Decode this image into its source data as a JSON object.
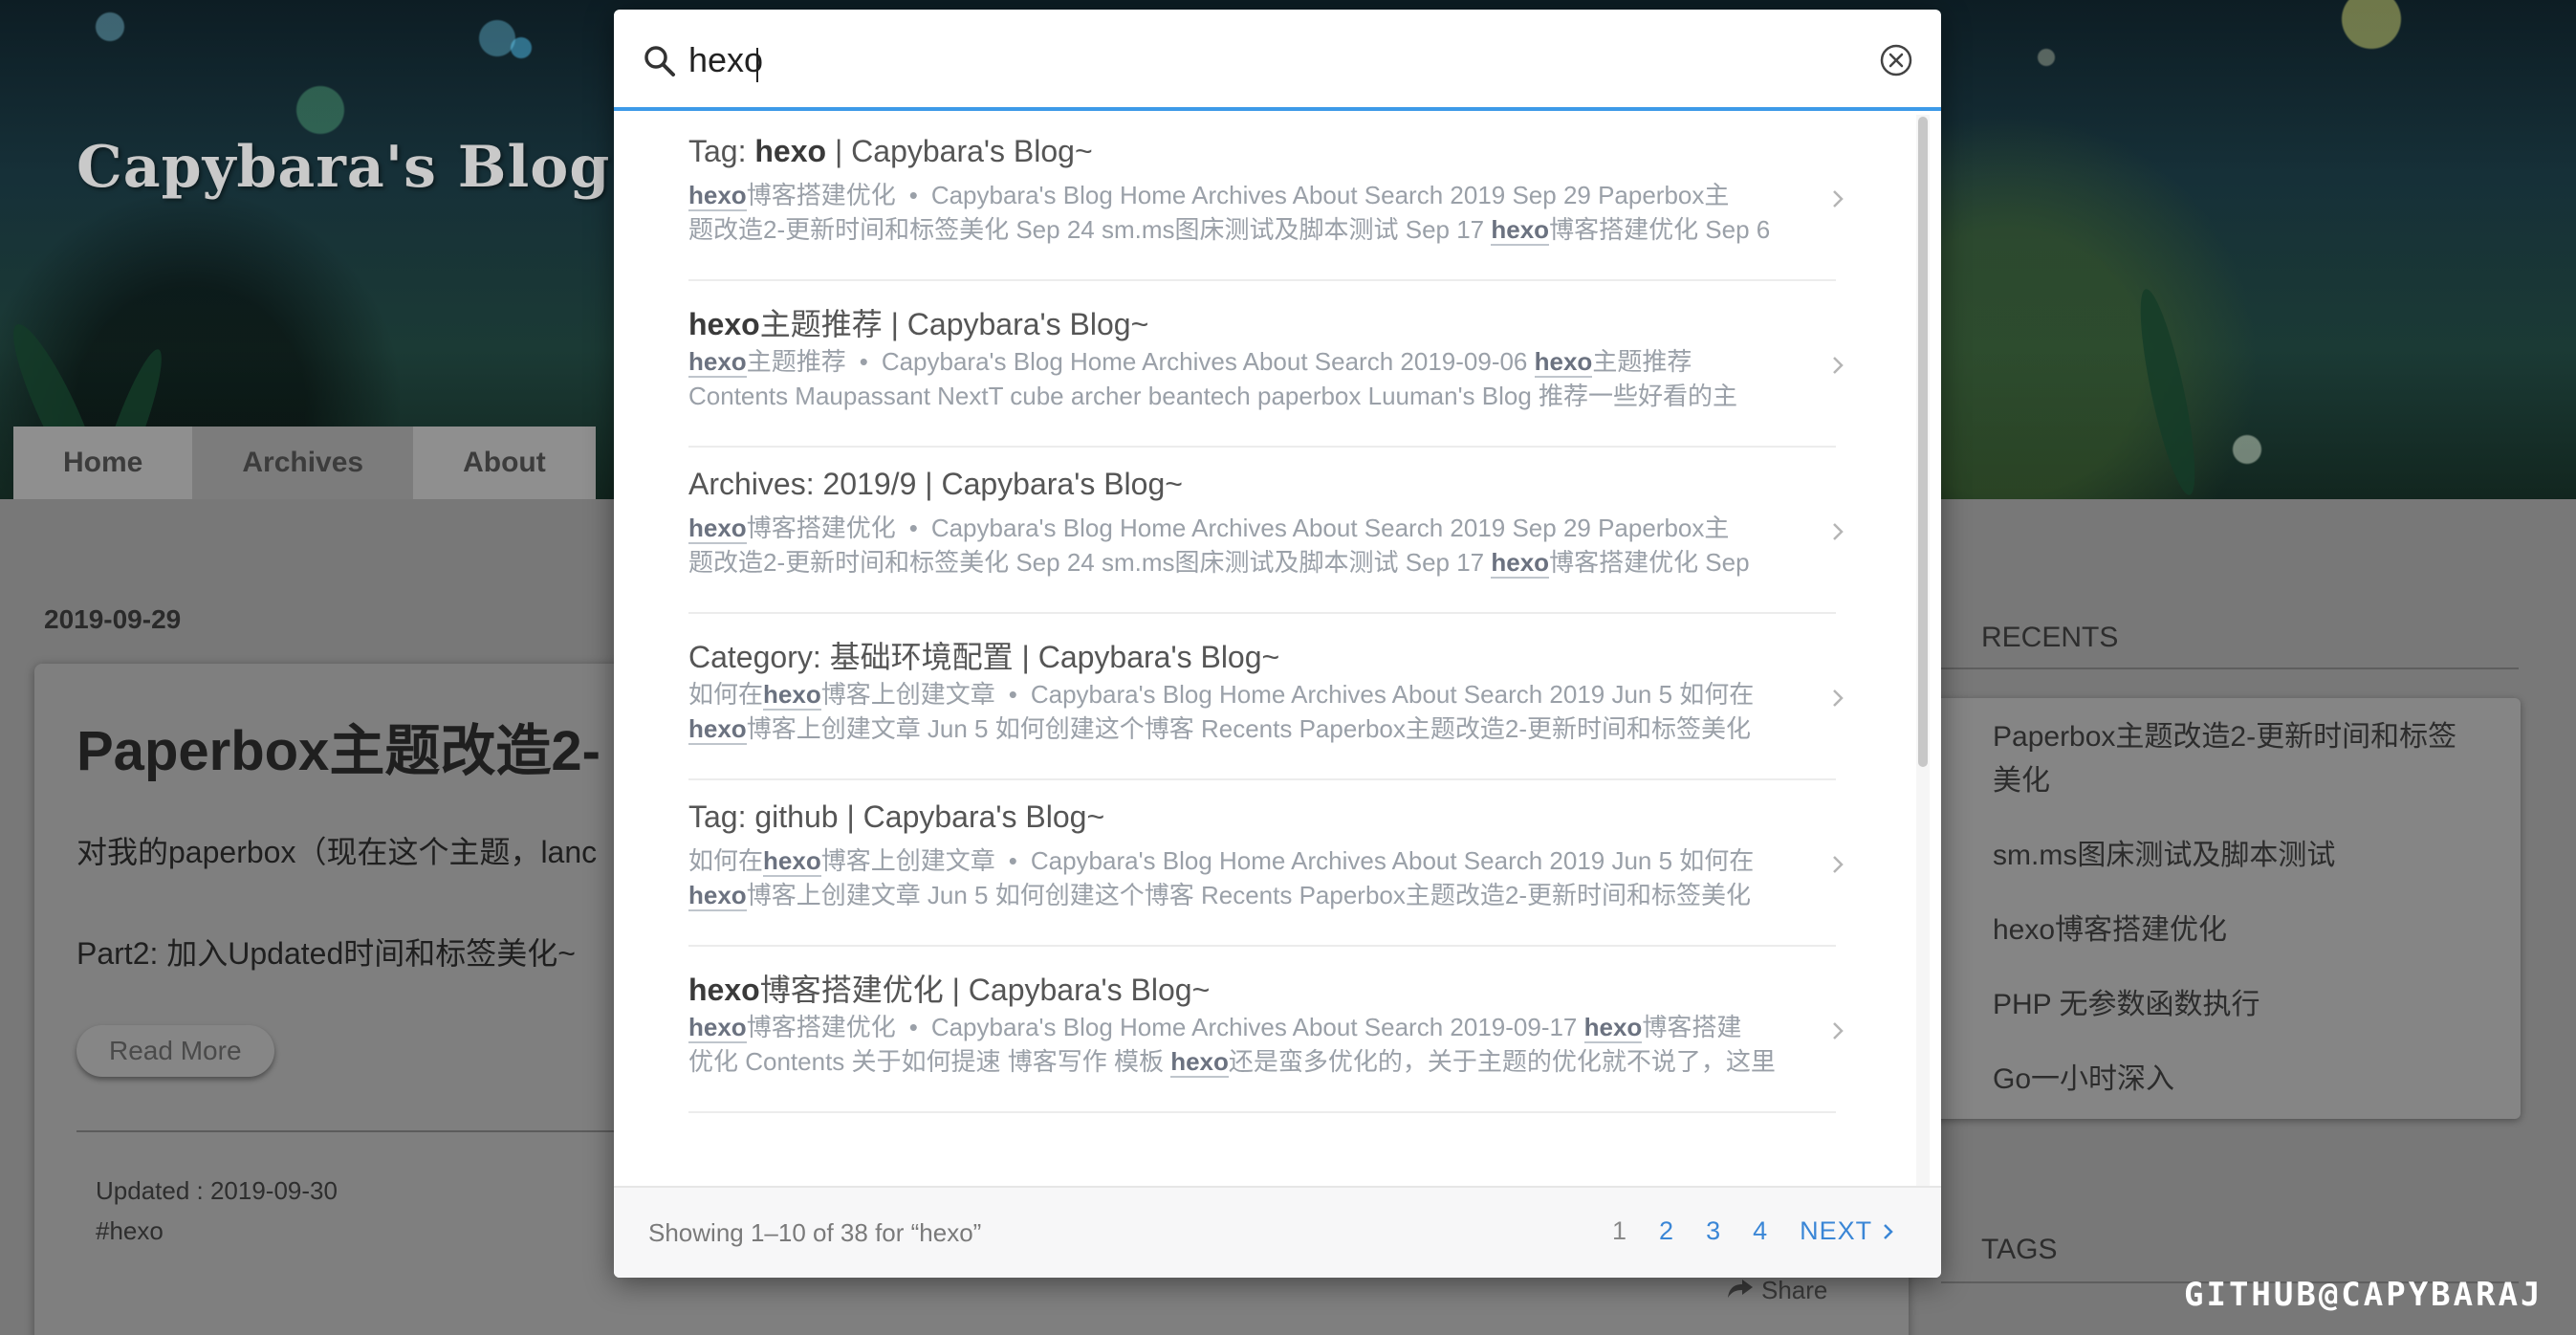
{
  "blog": {
    "title": "Capybara's Blog~",
    "nav": [
      "Home",
      "Archives",
      "About"
    ],
    "post": {
      "date": "2019-09-29",
      "title": "Paperbox主题改造2-",
      "line1": "对我的paperbox（现在这个主题，lanc",
      "line2": "Part2: 加入Updated时间和标签美化~",
      "read_more": "Read More",
      "updated": "Updated : 2019-09-30",
      "tag": "#hexo",
      "share": "Share"
    },
    "sidebar": {
      "recents_heading": "RECENTS",
      "recents": [
        "Paperbox主题改造2-更新时间和标签美化",
        "sm.ms图床测试及脚本测试",
        "hexo博客搭建优化",
        "PHP 无参数函数执行",
        "Go一小时深入"
      ],
      "tags_heading": "TAGS"
    },
    "watermark": "GITHUB@CAPYBARAJ"
  },
  "search": {
    "query": "hexo",
    "icons": {
      "search": "search-icon",
      "clear": "clear-circle-x-icon",
      "chevron": "chevron-right-icon"
    },
    "accent_color": "#3d9ae8",
    "results": [
      {
        "title_pre": "Tag: ",
        "title_kw": "hexo",
        "title_post": " | Capybara's Blog~",
        "line1": [
          [
            "kw",
            "hexo"
          ],
          [
            "t",
            "博客搭建优化"
          ],
          [
            "b",
            "•"
          ],
          [
            "t",
            "Capybara's Blog Home Archives About Search 2019 Sep 29 Paperbox主"
          ]
        ],
        "line2": [
          [
            "t",
            "题改造2-更新时间和标签美化 Sep 24 sm.ms图床测试及脚本测试 Sep 17 "
          ],
          [
            "kw",
            "hexo"
          ],
          [
            "t",
            "博客搭建优化 Sep 6"
          ]
        ]
      },
      {
        "title_pre": "",
        "title_kw": "hexo",
        "title_post": "主题推荐 | Capybara's Blog~",
        "line1": [
          [
            "kw",
            "hexo"
          ],
          [
            "t",
            "主题推荐"
          ],
          [
            "b",
            "•"
          ],
          [
            "t",
            "Capybara's Blog Home Archives About Search 2019-09-06 "
          ],
          [
            "kw",
            "hexo"
          ],
          [
            "t",
            "主题推荐"
          ]
        ],
        "line2": [
          [
            "t",
            "Contents Maupassant NextT cube archer beantech paperbox Luuman's Blog 推荐一些好看的主"
          ]
        ]
      },
      {
        "title_pre": "Archives: 2019/9 | Capybara's Blog~",
        "title_kw": "",
        "title_post": "",
        "line1": [
          [
            "kw",
            "hexo"
          ],
          [
            "t",
            "博客搭建优化"
          ],
          [
            "b",
            "•"
          ],
          [
            "t",
            "Capybara's Blog Home Archives About Search 2019 Sep 29 Paperbox主"
          ]
        ],
        "line2": [
          [
            "t",
            "题改造2-更新时间和标签美化 Sep 24 sm.ms图床测试及脚本测试 Sep 17 "
          ],
          [
            "kw",
            "hexo"
          ],
          [
            "t",
            "博客搭建优化 Sep"
          ]
        ]
      },
      {
        "title_pre": "Category: 基础环境配置 | Capybara's Blog~",
        "title_kw": "",
        "title_post": "",
        "line1": [
          [
            "t",
            "如何在"
          ],
          [
            "kw",
            "hexo"
          ],
          [
            "t",
            "博客上创建文章"
          ],
          [
            "b",
            "•"
          ],
          [
            "t",
            "Capybara's Blog Home Archives About Search 2019 Jun 5 如何在"
          ]
        ],
        "line2": [
          [
            "kw",
            "hexo"
          ],
          [
            "t",
            "博客上创建文章 Jun 5 如何创建这个博客 Recents Paperbox主题改造2-更新时间和标签美化"
          ]
        ]
      },
      {
        "title_pre": "Tag: github | Capybara's Blog~",
        "title_kw": "",
        "title_post": "",
        "line1": [
          [
            "t",
            "如何在"
          ],
          [
            "kw",
            "hexo"
          ],
          [
            "t",
            "博客上创建文章"
          ],
          [
            "b",
            "•"
          ],
          [
            "t",
            "Capybara's Blog Home Archives About Search 2019 Jun 5 如何在"
          ]
        ],
        "line2": [
          [
            "kw",
            "hexo"
          ],
          [
            "t",
            "博客上创建文章 Jun 5 如何创建这个博客 Recents Paperbox主题改造2-更新时间和标签美化"
          ]
        ]
      },
      {
        "title_pre": "",
        "title_kw": "hexo",
        "title_post": "博客搭建优化 | Capybara's Blog~",
        "line1": [
          [
            "kw",
            "hexo"
          ],
          [
            "t",
            "博客搭建优化"
          ],
          [
            "b",
            "•"
          ],
          [
            "t",
            "Capybara's Blog Home Archives About Search 2019-09-17 "
          ],
          [
            "kw",
            "hexo"
          ],
          [
            "t",
            "博客搭建"
          ]
        ],
        "line2": [
          [
            "t",
            "优化 Contents 关于如何提速 博客写作 模板 "
          ],
          [
            "kw",
            "hexo"
          ],
          [
            "t",
            "还是蛮多优化的，关于主题的优化就不说了，这里"
          ]
        ]
      }
    ],
    "footer": {
      "summary": "Showing 1–10 of 38 for “hexo”",
      "pages": [
        "1",
        "2",
        "3",
        "4"
      ],
      "current_page": "1",
      "next_label": "NEXT"
    }
  }
}
